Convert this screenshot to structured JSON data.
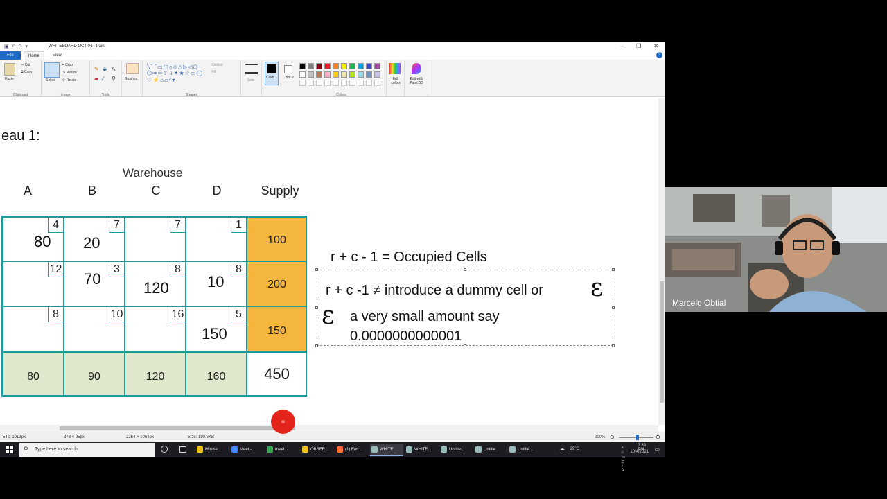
{
  "window": {
    "title": "WHITEBOARD OCT 04 - Paint",
    "tabs": [
      "File",
      "Home",
      "View"
    ]
  },
  "ribbon": {
    "clipboard": {
      "paste": "Paste",
      "cut": "Cut",
      "copy": "Copy",
      "label": "Clipboard"
    },
    "image": {
      "select": "Select",
      "crop": "Crop",
      "resize": "Resize",
      "rotate": "Rotate",
      "label": "Image"
    },
    "tools": {
      "label": "Tools"
    },
    "brushes": "Brushes",
    "shapes": {
      "outline": "Outline",
      "fill": "Fill",
      "label": "Shapes"
    },
    "size": "Size",
    "color1": "Color 1",
    "color2": "Color 2",
    "colors_label": "Colors",
    "edit_colors": "Edit colors",
    "edit_paint3d": "Edit with Paint 3D",
    "palette_row1": [
      "#000000",
      "#7f7f7f",
      "#880015",
      "#ed1c24",
      "#ff7f27",
      "#fff200",
      "#22b14c",
      "#00a2e8",
      "#3f48cc",
      "#a349a4"
    ],
    "palette_row2": [
      "#ffffff",
      "#c3c3c3",
      "#b97a57",
      "#ffaec9",
      "#ffc90e",
      "#efe4b0",
      "#b5e61d",
      "#99d9ea",
      "#7092be",
      "#c8bfe7"
    ]
  },
  "canvas": {
    "heading": "eau 1:",
    "warehouse_label": "Warehouse",
    "columns": [
      "A",
      "B",
      "C",
      "D",
      "Supply"
    ],
    "rows": [
      {
        "cells": [
          {
            "cost": "4",
            "alloc": "80"
          },
          {
            "cost": "7",
            "alloc": "20"
          },
          {
            "cost": "7",
            "alloc": ""
          },
          {
            "cost": "1",
            "alloc": ""
          }
        ],
        "supply": "100"
      },
      {
        "cells": [
          {
            "cost": "12",
            "alloc": ""
          },
          {
            "cost": "3",
            "alloc": "70"
          },
          {
            "cost": "8",
            "alloc": "120"
          },
          {
            "cost": "8",
            "alloc": "10"
          }
        ],
        "supply": "200"
      },
      {
        "cells": [
          {
            "cost": "8",
            "alloc": ""
          },
          {
            "cost": "10",
            "alloc": ""
          },
          {
            "cost": "16",
            "alloc": ""
          },
          {
            "cost": "5",
            "alloc": "150"
          }
        ],
        "supply": "150"
      }
    ],
    "demand": [
      "80",
      "90",
      "120",
      "160"
    ],
    "total": "450",
    "formula": "r + c - 1 = Occupied Cells",
    "note_line1": "r + c -1 ≠ introduce a dummy cell or",
    "epsilon": "ε",
    "note_line2": "a very small amount say",
    "note_line3": "0.0000000000001"
  },
  "status": {
    "cursor": "542, 1013px",
    "selection": "373 × 95px",
    "canvas_size": "2264 × 1064px",
    "file_size": "Size: 180.6KB",
    "zoom": "200%"
  },
  "taskbar": {
    "search_placeholder": "Type here to search",
    "apps": [
      {
        "label": "Mouse...",
        "color": "#f0c419"
      },
      {
        "label": "Meet -...",
        "color": "#4285f4"
      },
      {
        "label": "meet...",
        "color": "#34a853"
      },
      {
        "label": "OBSER...",
        "color": "#f0c419"
      },
      {
        "label": "(1) Fac...",
        "color": "#ff7139"
      },
      {
        "label": "WHITE...",
        "color": "#9bb"
      },
      {
        "label": "WHITE...",
        "color": "#9bb"
      },
      {
        "label": "Untitle...",
        "color": "#9bb"
      },
      {
        "label": "Untitle...",
        "color": "#9bb"
      },
      {
        "label": "Untitle...",
        "color": "#9bb"
      }
    ],
    "weather": "29°C",
    "time": "2:38 PM",
    "date": "10/4/2021"
  },
  "webcam": {
    "name": "Marcelo Obtial"
  }
}
